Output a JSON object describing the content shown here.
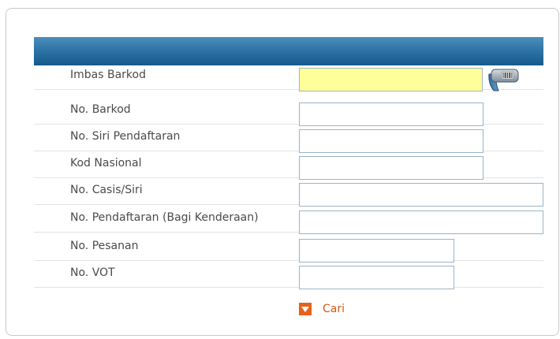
{
  "form": {
    "rows": [
      {
        "label": "Imbas Barkod",
        "value": ""
      },
      {
        "label": "No. Barkod",
        "value": ""
      },
      {
        "label": "No. Siri Pendaftaran",
        "value": ""
      },
      {
        "label": "Kod Nasional",
        "value": ""
      },
      {
        "label": "No. Casis/Siri",
        "value": ""
      },
      {
        "label": "No. Pendaftaran (Bagi Kenderaan)",
        "value": ""
      },
      {
        "label": "No. Pesanan",
        "value": ""
      },
      {
        "label": "No. VOT",
        "value": ""
      }
    ],
    "search_label": "Cari"
  },
  "icons": {
    "scanner": "barcode-scanner-icon",
    "search_arrow": "chevron-down-icon"
  },
  "colors": {
    "header_bar": "#2f74a6",
    "scan_field": "#ffff99",
    "search_accent": "#e8611a"
  }
}
